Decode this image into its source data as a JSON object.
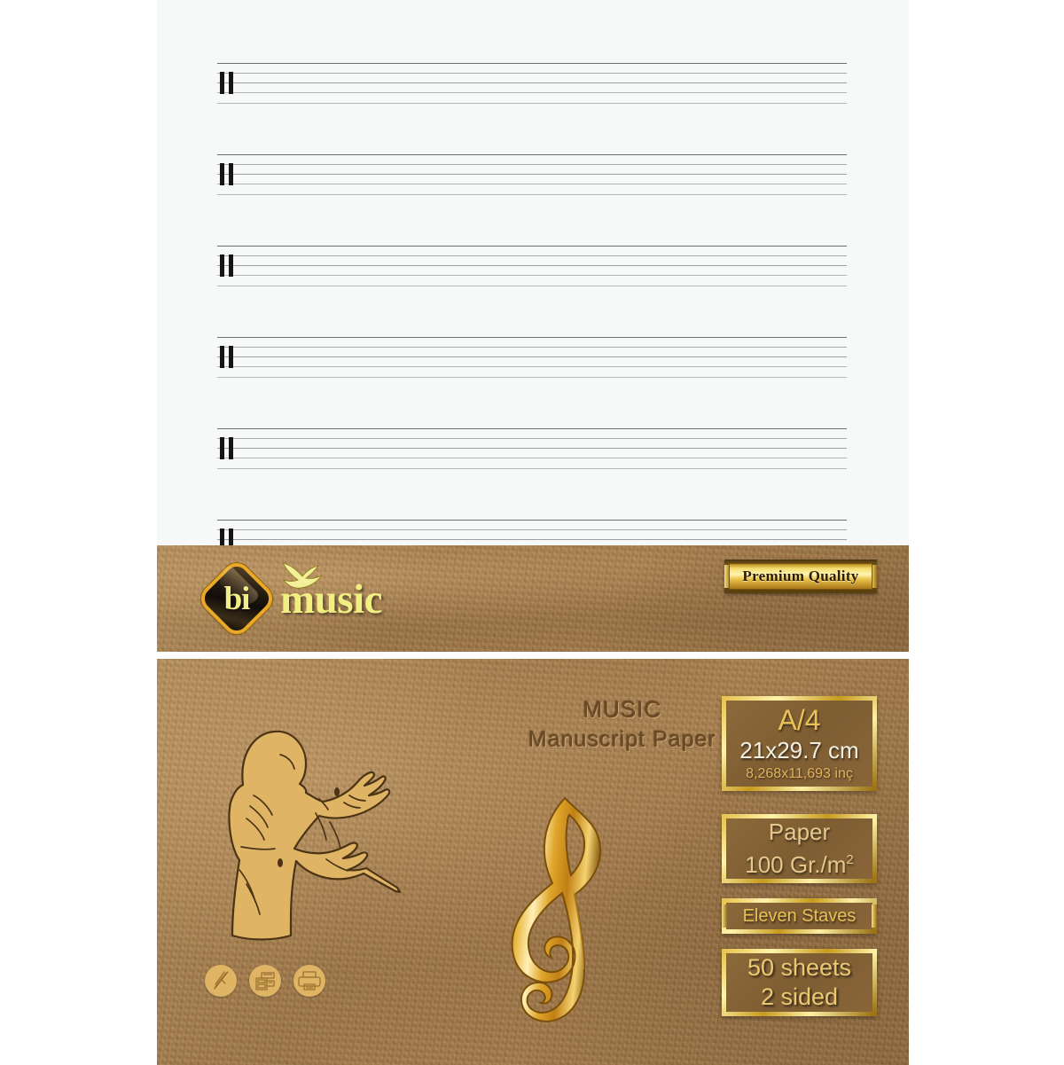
{
  "product": {
    "brand_name": "bi",
    "brand_word": "music",
    "badge": "Premium Quality",
    "title_line1": "MUSIC",
    "title_line2": "Manuscript Paper"
  },
  "specs": {
    "size_label": "A/4",
    "size_metric": "21x29.7 cm",
    "size_imperial": "8,268x11,693 inç",
    "paper_label": "Paper",
    "paper_weight": "100 Gr./m",
    "paper_weight_sup": "2",
    "staves": "Eleven Staves",
    "sheets_line1": "50 sheets",
    "sheets_line2": "2 sided"
  },
  "icons": {
    "pen": "pen-icon",
    "copier": "copier-icon",
    "printer": "printer-icon",
    "bird": "bird-icon",
    "clef": "treble-clef-icon",
    "conductor": "conductor-icon"
  },
  "colors": {
    "kraft": "#9d7445",
    "gold": "#e9c158",
    "gold_light": "#fff3ab",
    "sheet": "#f7f8f8",
    "staff_line": "#9a9a9a",
    "barline": "#151515",
    "tan_figure": "#dfb464",
    "title_text": "#6b4a25"
  },
  "sheet": {
    "staff_count": 6,
    "staff_lines_per_staff": 5,
    "staff_tops": [
      71,
      174,
      277,
      380,
      483,
      586
    ]
  }
}
